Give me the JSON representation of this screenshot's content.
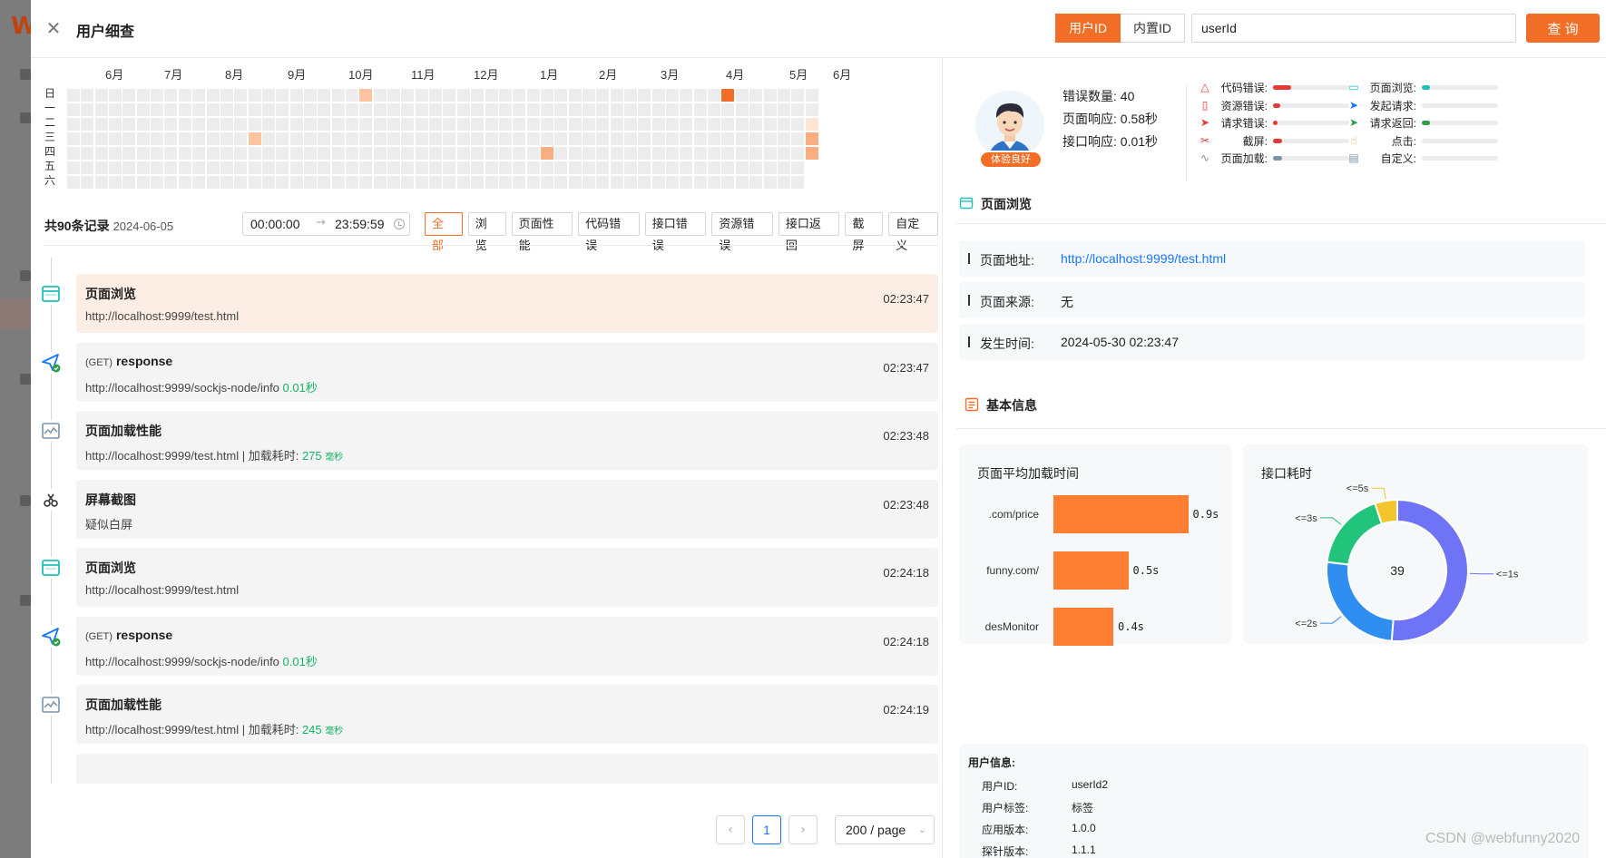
{
  "header": {
    "title": "用户细查",
    "id_types": [
      "用户ID",
      "内置ID"
    ],
    "user_input_value": "userId",
    "query_label": "查 询"
  },
  "heatmap": {
    "months": [
      "6月",
      "7月",
      "8月",
      "9月",
      "10月",
      "11月",
      "12月",
      "1月",
      "2月",
      "3月",
      "4月",
      "5月",
      "6月"
    ],
    "weekdays": [
      "日",
      "一",
      "二",
      "三",
      "四",
      "五",
      "六"
    ],
    "highlights": [
      {
        "week": 21,
        "day": 0,
        "level": 1
      },
      {
        "week": 47,
        "day": 0,
        "level": 3
      },
      {
        "week": 13,
        "day": 3,
        "level": 1
      },
      {
        "week": 34,
        "day": 4,
        "level": 2
      },
      {
        "week": 53,
        "day": 2,
        "level": 0
      },
      {
        "week": 53,
        "day": 3,
        "level": 2
      },
      {
        "week": 53,
        "day": 4,
        "level": 2
      }
    ]
  },
  "filter": {
    "record_count": "共90条记录",
    "date": "2024-06-05",
    "time_start": "00:00:00",
    "time_end": "23:59:59",
    "chips": [
      "全部",
      "浏览",
      "页面性能",
      "代码错误",
      "接口错误",
      "资源错误",
      "接口返回",
      "截屏",
      "自定义"
    ]
  },
  "timeline": [
    {
      "type": "page",
      "title": "页面浏览",
      "method": "",
      "sub": "http://localhost:9999/test.html",
      "green": "",
      "unit": "",
      "time": "02:23:47",
      "highlight": true
    },
    {
      "type": "request",
      "title": "response",
      "method": "(GET)",
      "sub": "http://localhost:9999/sockjs-node/info",
      "green": "0.01秒",
      "unit": "",
      "time": "02:23:47",
      "highlight": false
    },
    {
      "type": "perf",
      "title": "页面加载性能",
      "method": "",
      "sub": "http://localhost:9999/test.html | 加载耗时:",
      "green": "275",
      "unit": "毫秒",
      "time": "02:23:48",
      "highlight": false
    },
    {
      "type": "screenshot",
      "title": "屏幕截图",
      "method": "",
      "sub": "疑似白屏",
      "green": "",
      "unit": "",
      "time": "02:23:48",
      "highlight": false
    },
    {
      "type": "page",
      "title": "页面浏览",
      "method": "",
      "sub": "http://localhost:9999/test.html",
      "green": "",
      "unit": "",
      "time": "02:24:18",
      "highlight": false
    },
    {
      "type": "request",
      "title": "response",
      "method": "(GET)",
      "sub": "http://localhost:9999/sockjs-node/info",
      "green": "0.01秒",
      "unit": "",
      "time": "02:24:18",
      "highlight": false
    },
    {
      "type": "perf",
      "title": "页面加载性能",
      "method": "",
      "sub": "http://localhost:9999/test.html | 加载耗时:",
      "green": "245",
      "unit": "毫秒",
      "time": "02:24:19",
      "highlight": false
    }
  ],
  "pagination": {
    "current": "1",
    "page_size": "200 / page",
    "prev": "‹",
    "next": "›"
  },
  "profile": {
    "badge": "体验良好",
    "error_count": "错误数量: 40",
    "page_response": "页面响应: 0.58秒",
    "api_response": "接口响应: 0.01秒"
  },
  "mini_stats": [
    {
      "label": "代码错误:",
      "icon": "warning-icon",
      "glyph": "△",
      "color": "#e53935",
      "fill": 0.24
    },
    {
      "label": "资源错误:",
      "icon": "file-error-icon",
      "glyph": "▯",
      "color": "#e53935",
      "fill": 0.1
    },
    {
      "label": "请求错误:",
      "icon": "send-error-icon",
      "glyph": "➤",
      "color": "#e53935",
      "fill": 0.06
    },
    {
      "label": "截屏:",
      "icon": "scissors-icon",
      "glyph": "✂",
      "color": "#e53935",
      "fill": 0.12
    },
    {
      "label": "页面加载:",
      "icon": "chart-wave-icon",
      "glyph": "∿",
      "color": "#7b93a8",
      "fill": 0.12
    },
    {
      "label": "页面浏览:",
      "icon": "browser-icon",
      "glyph": "▭",
      "color": "#20c0b8",
      "fill": 0.11
    },
    {
      "label": "发起请求:",
      "icon": "send-icon",
      "glyph": "➤",
      "color": "#1677ff",
      "fill": 0.0
    },
    {
      "label": "请求返回:",
      "icon": "send-check-icon",
      "glyph": "➤",
      "color": "#2e9d4a",
      "fill": 0.11
    },
    {
      "label": "点击:",
      "icon": "click-icon",
      "glyph": "☝",
      "color": "#f29b38",
      "fill": 0.0
    },
    {
      "label": "自定义:",
      "icon": "custom-icon",
      "glyph": "▤",
      "color": "#7b93a8",
      "fill": 0.0
    }
  ],
  "page_view": {
    "title": "页面浏览",
    "fields": [
      {
        "key": "页面地址:",
        "value": "http://localhost:9999/test.html",
        "link": true
      },
      {
        "key": "页面来源:",
        "value": "无",
        "link": false
      },
      {
        "key": "发生时间:",
        "value": "2024-05-30 02:23:47",
        "link": false
      }
    ]
  },
  "basic_info": {
    "title": "基本信息"
  },
  "chart_data": [
    {
      "type": "bar",
      "title": "页面平均加载时间",
      "categories": [
        ".com/price",
        "funny.com/",
        "desMonitor"
      ],
      "values": [
        0.9,
        0.5,
        0.4
      ],
      "value_labels": [
        "0.9s",
        "0.5s",
        "0.4s"
      ],
      "orientation": "horizontal",
      "color": "#ff7f32"
    },
    {
      "type": "pie",
      "title": "接口耗时",
      "center_label": "39",
      "categories": [
        "<=1s",
        "<=2s",
        "<=3s",
        "<=5s"
      ],
      "values": [
        20,
        10,
        7,
        2
      ],
      "colors": [
        "#6f73f5",
        "#2f8ef0",
        "#22c37a",
        "#f5c52d"
      ]
    }
  ],
  "user_info": {
    "title": "用户信息:",
    "rows": [
      {
        "key": "用户ID:",
        "value": "userId2"
      },
      {
        "key": "用户标签:",
        "value": "标签"
      },
      {
        "key": "应用版本:",
        "value": "1.0.0"
      },
      {
        "key": "探针版本:",
        "value": "1.1.1"
      }
    ]
  },
  "watermark": "CSDN @webfunny2020"
}
